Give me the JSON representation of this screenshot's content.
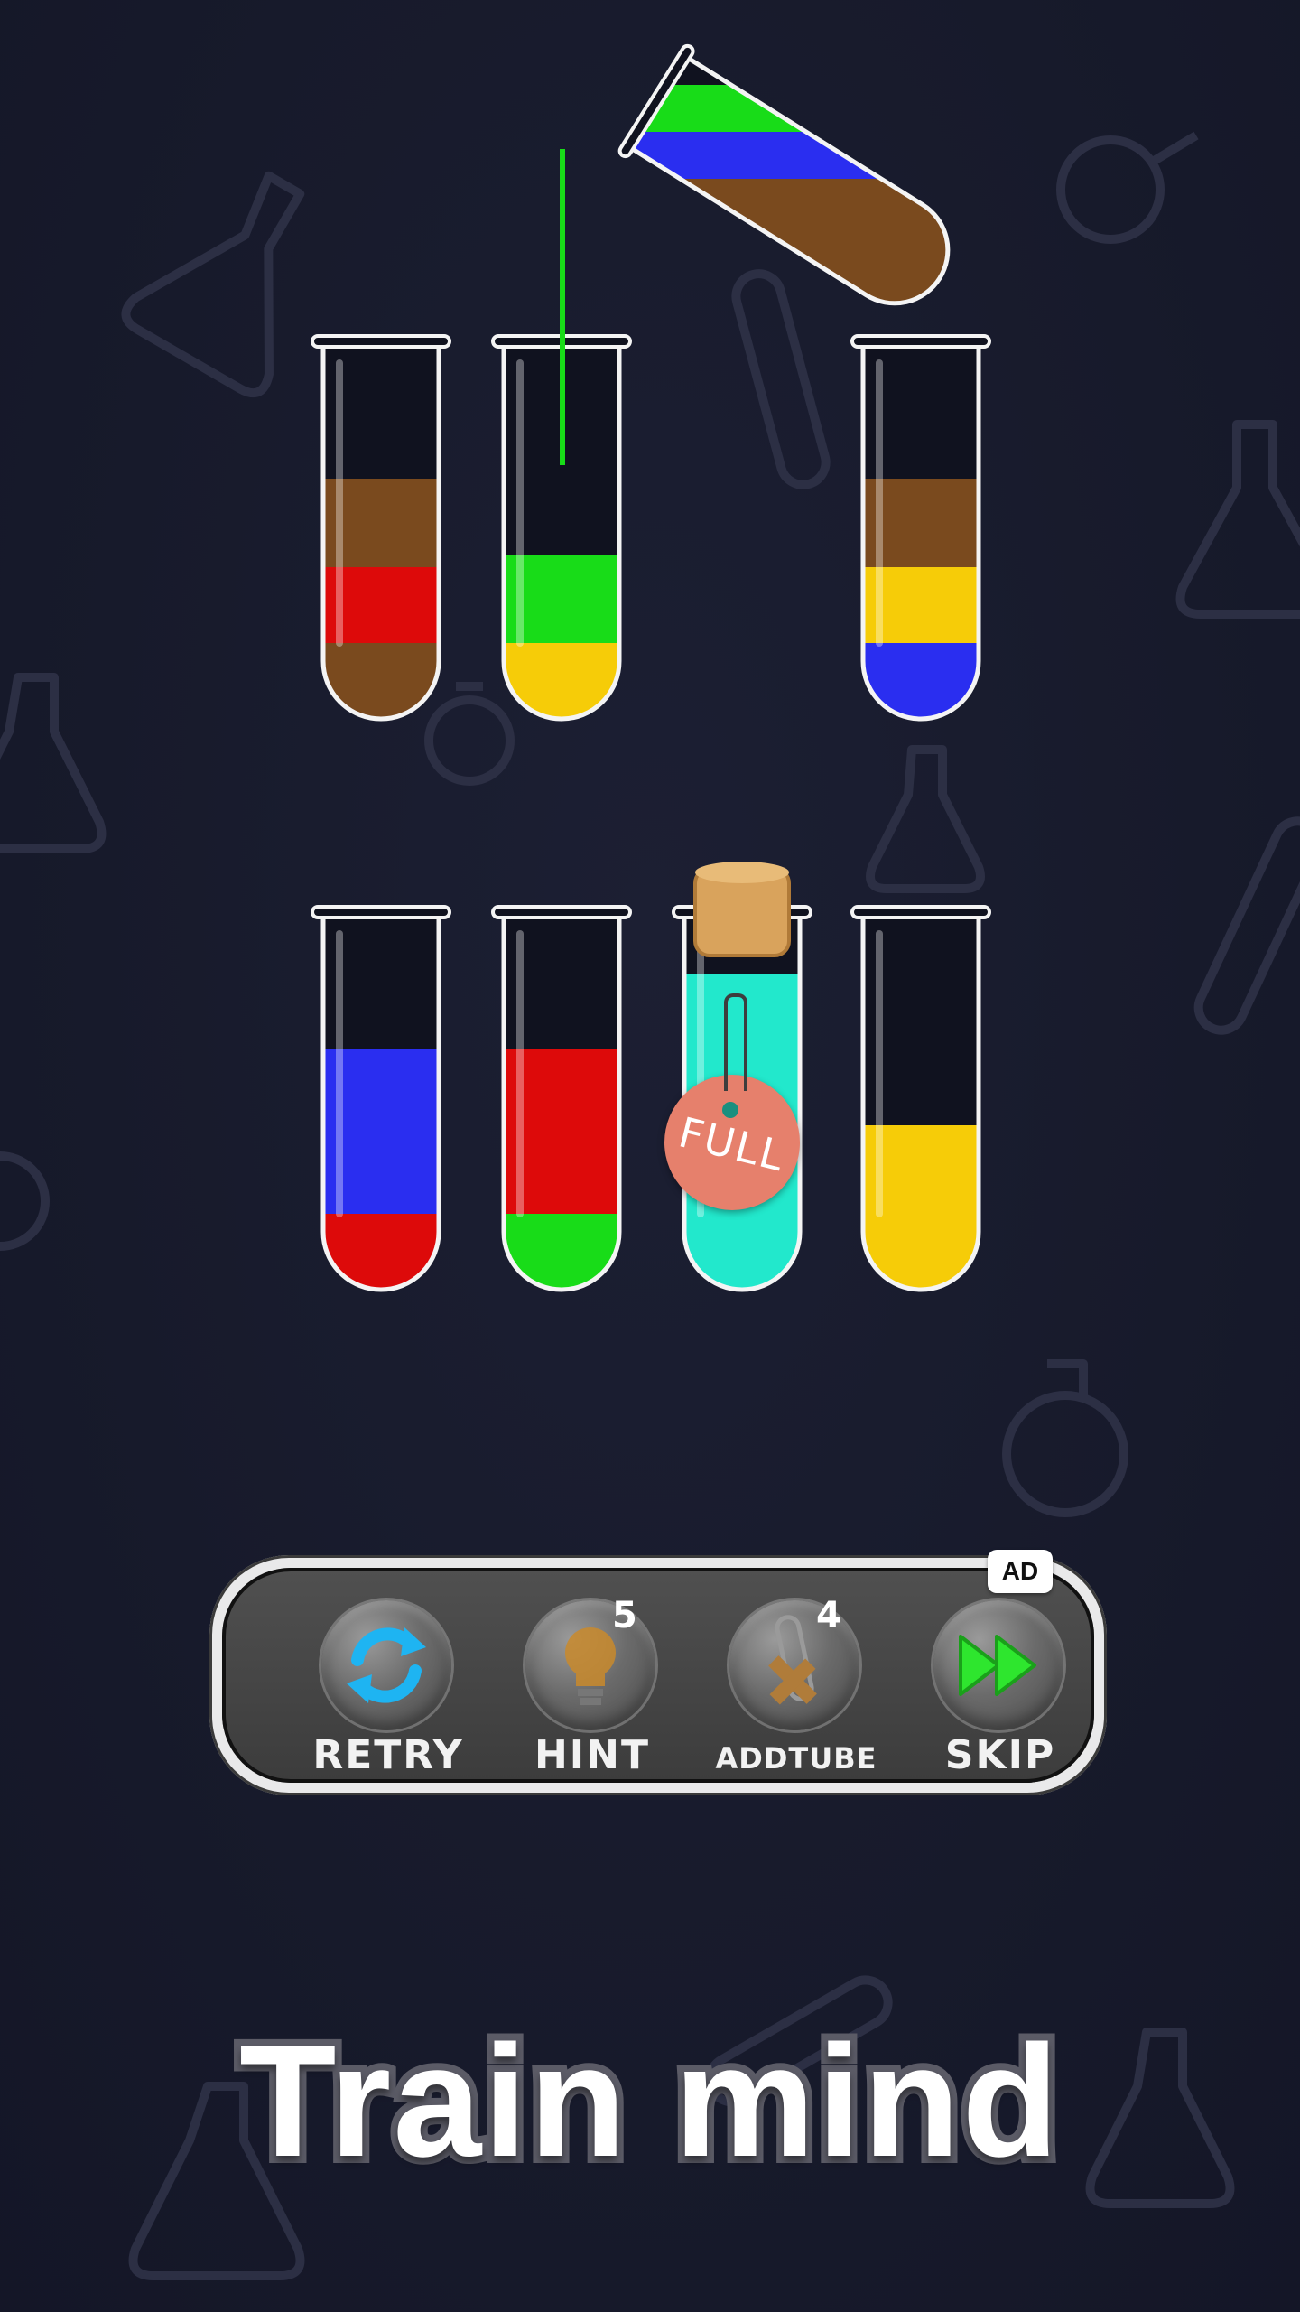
{
  "colors": {
    "background": "#181a2c",
    "brown": "#7a4a1e",
    "red": "#dd0a0a",
    "green": "#18dc18",
    "yellow": "#f6cc08",
    "blue": "#2a2ef0",
    "teal": "#22e8cc",
    "full_tag": "#e6806c"
  },
  "tubes": [
    {
      "name": "tube-1",
      "layers_bottom_to_top": [
        "brown",
        "red",
        "brown"
      ]
    },
    {
      "name": "tube-2",
      "layers_bottom_to_top": [
        "yellow",
        "green"
      ],
      "receiving_pour": true
    },
    {
      "name": "tube-3",
      "layers_bottom_to_top": [
        "blue",
        "yellow",
        "brown"
      ]
    },
    {
      "name": "tube-4",
      "layers_bottom_to_top": [
        "red",
        "blue",
        "blue"
      ]
    },
    {
      "name": "tube-5",
      "layers_bottom_to_top": [
        "green",
        "red",
        "red"
      ]
    },
    {
      "name": "tube-6",
      "layers_bottom_to_top": [
        "teal",
        "teal",
        "teal",
        "teal"
      ],
      "corked": true
    },
    {
      "name": "tube-7",
      "layers_bottom_to_top": [
        "yellow",
        "yellow"
      ]
    }
  ],
  "pouring_tube": {
    "layers_bottom_to_top": [
      "brown",
      "blue",
      "green"
    ],
    "pour_color": "green"
  },
  "full_tag": {
    "text": "FULL"
  },
  "toolbar": {
    "retry": {
      "label": "RETRY",
      "icon": "refresh-icon"
    },
    "hint": {
      "label": "HINT",
      "count": "5",
      "icon": "lightbulb-icon"
    },
    "addtube": {
      "label": "ADDTUBE",
      "count": "4",
      "icon": "add-tube-icon"
    },
    "skip": {
      "label": "SKIP",
      "badge": "AD",
      "icon": "fast-forward-icon"
    }
  },
  "slogan": "Train mind"
}
